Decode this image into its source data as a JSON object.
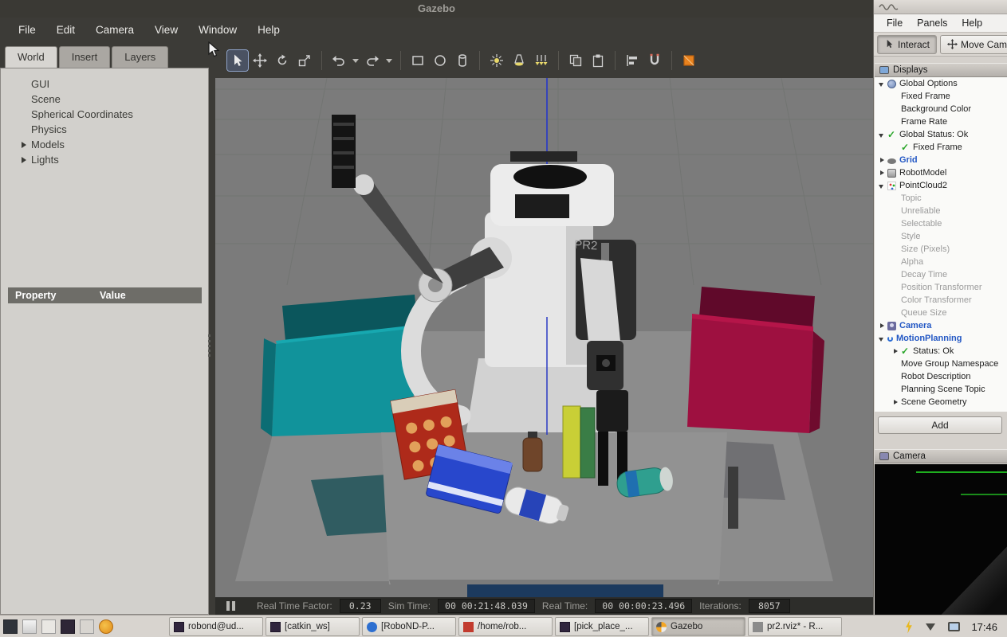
{
  "gazebo": {
    "window_title": "Gazebo",
    "menu": [
      "File",
      "Edit",
      "Camera",
      "View",
      "Window",
      "Help"
    ],
    "panel_tabs": [
      {
        "label": "World",
        "cls": "active"
      },
      {
        "label": "Insert",
        "cls": ""
      },
      {
        "label": "Layers",
        "cls": ""
      }
    ],
    "world_tree": [
      {
        "label": "GUI",
        "cls": ""
      },
      {
        "label": "Scene",
        "cls": ""
      },
      {
        "label": "Spherical Coordinates",
        "cls": ""
      },
      {
        "label": "Physics",
        "cls": ""
      },
      {
        "label": "Models",
        "cls": "exp"
      },
      {
        "label": "Lights",
        "cls": "exp"
      }
    ],
    "property_table": {
      "property_col": "Property",
      "value_col": "Value"
    },
    "toolbar_icon_names": [
      "select-tool-icon",
      "translate-tool-icon",
      "rotate-tool-icon",
      "scale-tool-icon",
      "undo-icon",
      "redo-icon",
      "box-shape-icon",
      "sphere-shape-icon",
      "cylinder-shape-icon",
      "point-light-icon",
      "spot-light-icon",
      "directional-light-icon",
      "copy-icon",
      "paste-icon",
      "align-icon",
      "snap-icon",
      "view-angle-icon"
    ],
    "statusbar": {
      "rtf_label": "Real Time Factor:",
      "rtf_value": "0.23",
      "sim_time_label": "Sim Time:",
      "sim_time_value": "00 00:21:48.039",
      "real_time_label": "Real Time:",
      "real_time_value": "00 00:00:23.496",
      "iterations_label": "Iterations:",
      "iterations_value": "8057"
    },
    "scene_label": "PR2",
    "scene_colors": {
      "viewport_bg": "#7b7b7b",
      "table": "#8c8c8c",
      "left_bin": "#11939b",
      "right_bin": "#9e1040",
      "axis_line": "#2b3bc4"
    }
  },
  "rviz": {
    "menu": [
      "File",
      "Panels",
      "Help"
    ],
    "tools": [
      {
        "label": "Interact",
        "cls": "pressed"
      },
      {
        "label": "Move Camera",
        "cls": ""
      }
    ],
    "displays_panel_title": "Displays",
    "displays_tree": [
      {
        "label": "Global Options",
        "cls": "exp-down icon-globe"
      },
      {
        "label": "Fixed Frame",
        "cls": "lvl1"
      },
      {
        "label": "Background Color",
        "cls": "lvl1"
      },
      {
        "label": "Frame Rate",
        "cls": "lvl1"
      },
      {
        "label": "Global Status: Ok",
        "cls": "exp-down icon-check"
      },
      {
        "label": "Fixed Frame",
        "cls": "lvl1 icon-check"
      },
      {
        "label": "Grid",
        "cls": "exp-right icon-eye blue"
      },
      {
        "label": "RobotModel",
        "cls": "exp-right icon-robot"
      },
      {
        "label": "PointCloud2",
        "cls": "exp-down icon-points"
      },
      {
        "label": "Topic",
        "cls": "lvl1 gray"
      },
      {
        "label": "Unreliable",
        "cls": "lvl1 gray"
      },
      {
        "label": "Selectable",
        "cls": "lvl1 gray"
      },
      {
        "label": "Style",
        "cls": "lvl1 gray"
      },
      {
        "label": "Size (Pixels)",
        "cls": "lvl1 gray"
      },
      {
        "label": "Alpha",
        "cls": "lvl1 gray"
      },
      {
        "label": "Decay Time",
        "cls": "lvl1 gray"
      },
      {
        "label": "Position Transformer",
        "cls": "lvl1 gray"
      },
      {
        "label": "Color Transformer",
        "cls": "lvl1 gray"
      },
      {
        "label": "Queue Size",
        "cls": "lvl1 gray"
      },
      {
        "label": "Camera",
        "cls": "exp-right icon-camera blue"
      },
      {
        "label": "MotionPlanning",
        "cls": "exp-down icon-motion blue"
      },
      {
        "label": "Status: Ok",
        "cls": "lvl1 exp-right icon-check"
      },
      {
        "label": "Move Group Namespace",
        "cls": "lvl1"
      },
      {
        "label": "Robot Description",
        "cls": "lvl1"
      },
      {
        "label": "Planning Scene Topic",
        "cls": "lvl1"
      },
      {
        "label": "Scene Geometry",
        "cls": "lvl1 exp-right"
      }
    ],
    "add_button_label": "Add",
    "camera_panel_title": "Camera"
  },
  "taskbar": {
    "launchers": [
      {
        "name": "show-desktop-icon",
        "cls": "l-desktop"
      },
      {
        "name": "window-list-icon",
        "cls": "l-window"
      },
      {
        "name": "file-manager-icon",
        "cls": "l-files"
      },
      {
        "name": "terminal-launcher-icon",
        "cls": "l-terminal"
      },
      {
        "name": "text-editor-icon",
        "cls": "l-editor"
      },
      {
        "name": "gazebo-launcher-icon",
        "cls": "l-gazebo"
      }
    ],
    "windows": [
      {
        "label": "robond@ud...",
        "cls": "ic-terminal"
      },
      {
        "label": "[catkin_ws]",
        "cls": "ic-terminal"
      },
      {
        "label": "[RoboND-P...",
        "cls": "ic-code"
      },
      {
        "label": "/home/rob...",
        "cls": "ic-editor"
      },
      {
        "label": "[pick_place_...",
        "cls": "ic-terminal"
      },
      {
        "label": "Gazebo",
        "cls": "ic-gazebo active"
      },
      {
        "label": "pr2.rviz* - R...",
        "cls": "ic-rviz"
      }
    ],
    "tray_icons": [
      {
        "name": "power-icon",
        "cls": "tray-bolt"
      },
      {
        "name": "updates-icon",
        "cls": "tray-arrow"
      },
      {
        "name": "display-icon",
        "cls": "tray-display"
      }
    ],
    "clock": "17:46"
  }
}
